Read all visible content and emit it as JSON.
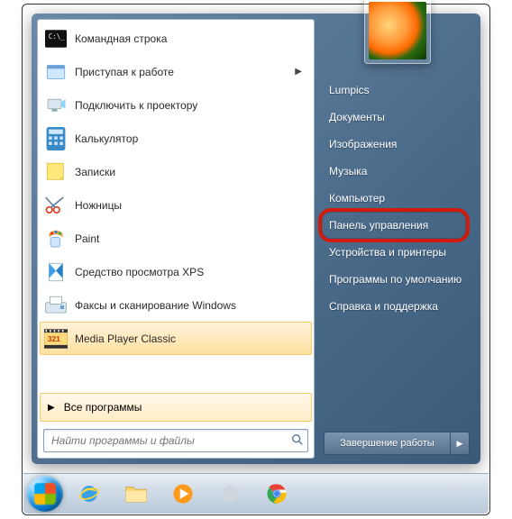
{
  "left_panel": {
    "programs": [
      {
        "label": "Командная строка",
        "icon": "cmd",
        "has_submenu": false
      },
      {
        "label": "Приступая к работе",
        "icon": "getting-started",
        "has_submenu": true
      },
      {
        "label": "Подключить к проектору",
        "icon": "projector",
        "has_submenu": false
      },
      {
        "label": "Калькулятор",
        "icon": "calculator",
        "has_submenu": false
      },
      {
        "label": "Записки",
        "icon": "sticky-notes",
        "has_submenu": false
      },
      {
        "label": "Ножницы",
        "icon": "snipping-tool",
        "has_submenu": false
      },
      {
        "label": "Paint",
        "icon": "paint",
        "has_submenu": false
      },
      {
        "label": "Средство просмотра XPS",
        "icon": "xps-viewer",
        "has_submenu": false
      },
      {
        "label": "Факсы и сканирование Windows",
        "icon": "fax-scan",
        "has_submenu": false
      },
      {
        "label": "Media Player Classic",
        "icon": "mpc",
        "has_submenu": false,
        "highlighted": true
      }
    ],
    "all_programs": "Все программы",
    "search_placeholder": "Найти программы и файлы"
  },
  "right_panel": {
    "items": [
      "Lumpics",
      "Документы",
      "Изображения",
      "Музыка",
      "Компьютер",
      "Панель управления",
      "Устройства и принтеры",
      "Программы по умолчанию",
      "Справка и поддержка"
    ],
    "highlighted_index": 5
  },
  "shutdown_label": "Завершение работы",
  "colors": {
    "highlight_ring": "#d11a0a"
  }
}
